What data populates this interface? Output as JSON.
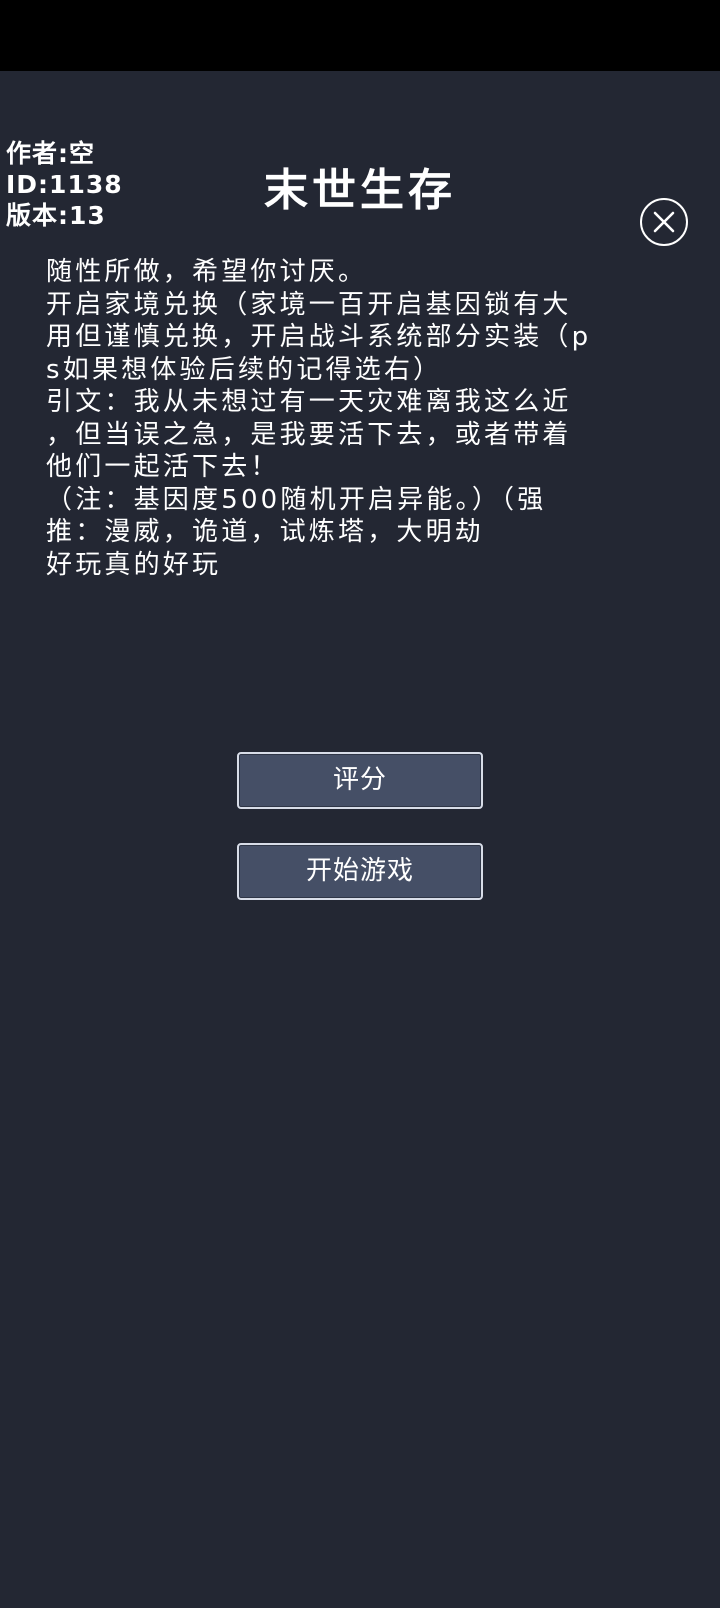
{
  "meta": {
    "author": "作者:空",
    "id": "ID:1138",
    "version": "版本:13"
  },
  "title": "末世生存",
  "close": {
    "icon": "close-icon"
  },
  "description": {
    "lines": [
      "随性所做，希望你讨厌。",
      "开启家境兑换（家境一百开启基因锁有大",
      "用但谨慎兑换，开启战斗系统部分实装（p",
      "s如果想体验后续的记得选右）",
      "引文：我从未想过有一天灾难离我这么近",
      "，但当误之急，是我要活下去，或者带着",
      "他们一起活下去！",
      "（注：基因度500随机开启异能。）（强",
      "推：漫威，诡道，试炼塔，大明劫",
      "好玩真的好玩"
    ]
  },
  "buttons": {
    "rate": "评分",
    "start": "开始游戏"
  },
  "colors": {
    "background": "#232733",
    "button_fill": "#454f66",
    "button_border": "#d8dde8"
  }
}
